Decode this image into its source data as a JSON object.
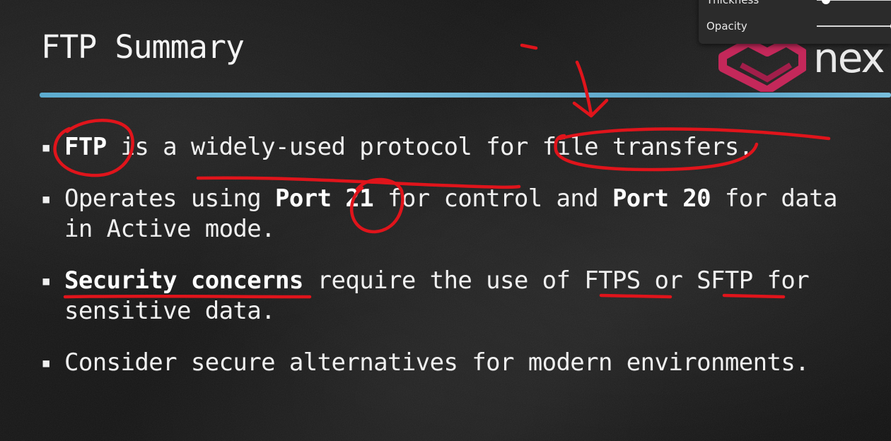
{
  "slide": {
    "title": "FTP Summary",
    "bullets": [
      {
        "parts": [
          {
            "text": "FTP",
            "bold": true
          },
          {
            "text": " is a widely-used protocol for file transfers.",
            "bold": false
          }
        ]
      },
      {
        "parts": [
          {
            "text": "Operates using ",
            "bold": false
          },
          {
            "text": "Port 21",
            "bold": true
          },
          {
            "text": " for control and ",
            "bold": false
          },
          {
            "text": "Port 20",
            "bold": true
          },
          {
            "text": " for data in Active mode.",
            "bold": false
          }
        ]
      },
      {
        "parts": [
          {
            "text": "Security concerns",
            "bold": true
          },
          {
            "text": " require the use of FTPS or SFTP for sensitive data.",
            "bold": false
          }
        ]
      },
      {
        "parts": [
          {
            "text": "Consider secure alternatives for modern environments.",
            "bold": false
          }
        ]
      }
    ],
    "bullet_marker": "▪",
    "accent_rule_color": "#6bbde0"
  },
  "logo": {
    "icon": "heart-shield-logo-icon",
    "text": "nex",
    "color": "#c8275a"
  },
  "pen_panel": {
    "thickness_label": "Thickness",
    "opacity_label": "Opacity",
    "thickness_value": 0.12,
    "opacity_value": 1.0
  },
  "annotations": {
    "ink_color": "#e0141b"
  }
}
